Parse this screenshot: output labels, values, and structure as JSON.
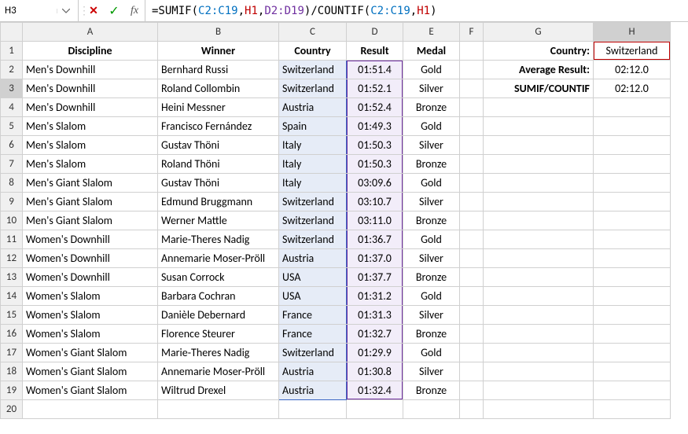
{
  "nameBox": "H3",
  "formula": {
    "pre": "=SUMIF",
    "p1o": "(",
    "r1": "C2:C19",
    "c1": ",",
    "r2": "H1",
    "c2": ",",
    "r3": "D2:D19",
    "p1c": ")",
    "mid": "/COUNTIF",
    "p2o": "(",
    "r4": "C2:C19",
    "c3": ",",
    "r5": "H1",
    "p2c": ")"
  },
  "cols": [
    "A",
    "B",
    "C",
    "D",
    "E",
    "F",
    "G",
    "H"
  ],
  "headers": {
    "A": "Discipline",
    "B": "Winner",
    "C": "Country",
    "D": "Result",
    "E": "Medal"
  },
  "rows": [
    {
      "n": 2,
      "A": "Men's Downhill",
      "B": "Bernhard Russi",
      "C": "Switzerland",
      "D": "01:51.4",
      "E": "Gold"
    },
    {
      "n": 3,
      "A": "Men's Downhill",
      "B": "Roland Collombin",
      "C": "Switzerland",
      "D": "01:52.1",
      "E": "Silver"
    },
    {
      "n": 4,
      "A": "Men's Downhill",
      "B": "Heini Messner",
      "C": "Austria",
      "D": "01:52.4",
      "E": "Bronze"
    },
    {
      "n": 5,
      "A": "Men's Slalom",
      "B": "Francisco Fernández",
      "C": "Spain",
      "D": "01:49.3",
      "E": "Gold"
    },
    {
      "n": 6,
      "A": "Men's Slalom",
      "B": "Gustav Thöni",
      "C": "Italy",
      "D": "01:50.3",
      "E": "Silver"
    },
    {
      "n": 7,
      "A": "Men's Slalom",
      "B": "Roland Thöni",
      "C": "Italy",
      "D": "01:50.3",
      "E": "Bronze"
    },
    {
      "n": 8,
      "A": "Men's Giant Slalom",
      "B": "Gustav Thöni",
      "C": "Italy",
      "D": "03:09.6",
      "E": "Gold"
    },
    {
      "n": 9,
      "A": "Men's Giant Slalom",
      "B": "Edmund Bruggmann",
      "C": "Switzerland",
      "D": "03:10.7",
      "E": "Silver"
    },
    {
      "n": 10,
      "A": "Men's Giant Slalom",
      "B": "Werner Mattle",
      "C": "Switzerland",
      "D": "03:11.0",
      "E": "Bronze"
    },
    {
      "n": 11,
      "A": "Women's Downhill",
      "B": "Marie-Theres Nadig",
      "C": "Switzerland",
      "D": "01:36.7",
      "E": "Gold"
    },
    {
      "n": 12,
      "A": "Women's Downhill",
      "B": "Annemarie Moser-Pröll",
      "C": "Austria",
      "D": "01:37.0",
      "E": "Silver"
    },
    {
      "n": 13,
      "A": "Women's Downhill",
      "B": "Susan Corrock",
      "C": "USA",
      "D": "01:37.7",
      "E": "Bronze"
    },
    {
      "n": 14,
      "A": "Women's Slalom",
      "B": "Barbara Cochran",
      "C": "USA",
      "D": "01:31.2",
      "E": "Gold"
    },
    {
      "n": 15,
      "A": "Women's Slalom",
      "B": "Danièle Debernard",
      "C": "France",
      "D": "01:31.3",
      "E": "Silver"
    },
    {
      "n": 16,
      "A": "Women's Slalom",
      "B": "Florence Steurer",
      "C": "France",
      "D": "01:32.7",
      "E": "Bronze"
    },
    {
      "n": 17,
      "A": "Women's Giant Slalom",
      "B": "Marie-Theres Nadig",
      "C": "Switzerland",
      "D": "01:29.9",
      "E": "Gold"
    },
    {
      "n": 18,
      "A": "Women's Giant Slalom",
      "B": "Annemarie Moser-Pröll",
      "C": "Austria",
      "D": "01:30.8",
      "E": "Silver"
    },
    {
      "n": 19,
      "A": "Women's Giant Slalom",
      "B": "Wiltrud Drexel",
      "C": "Austria",
      "D": "01:32.4",
      "E": "Bronze"
    }
  ],
  "side": {
    "countryLabel": "Country:",
    "countryValue": "Switzerland",
    "avgLabel": "Average Result:",
    "avgValue": "02:12.0",
    "sumifLabel": "SUMIF/COUNTIF",
    "sumifValue": "02:12.0"
  }
}
